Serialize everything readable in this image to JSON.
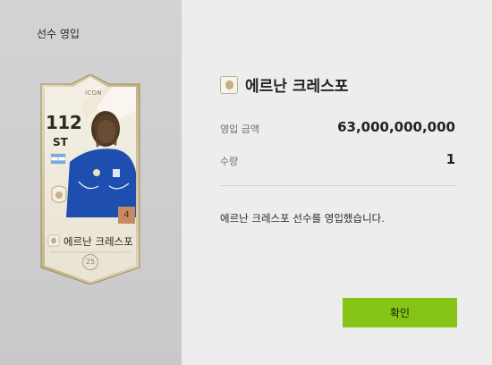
{
  "dialog": {
    "title": "선수 영입"
  },
  "card": {
    "type": "ICON",
    "rating": "112",
    "position": "ST",
    "name": "에르난 크레스포",
    "level": "4",
    "ovr_badge": "25",
    "nation_flag": "argentina-flag-icon",
    "season_icon": "icon-season-icon"
  },
  "player": {
    "name": "에르난 크레스포"
  },
  "details": {
    "price_label": "영입 금액",
    "price_value": "63,000,000,000",
    "quantity_label": "수량",
    "quantity_value": "1"
  },
  "message": "에르난 크레스포 선수를 영입했습니다.",
  "buttons": {
    "confirm_label": "확인"
  },
  "colors": {
    "confirm_button": "#86c516",
    "card_level_badge": "#c78a62",
    "left_panel": "#cdcdcf",
    "right_panel": "#ededee"
  }
}
